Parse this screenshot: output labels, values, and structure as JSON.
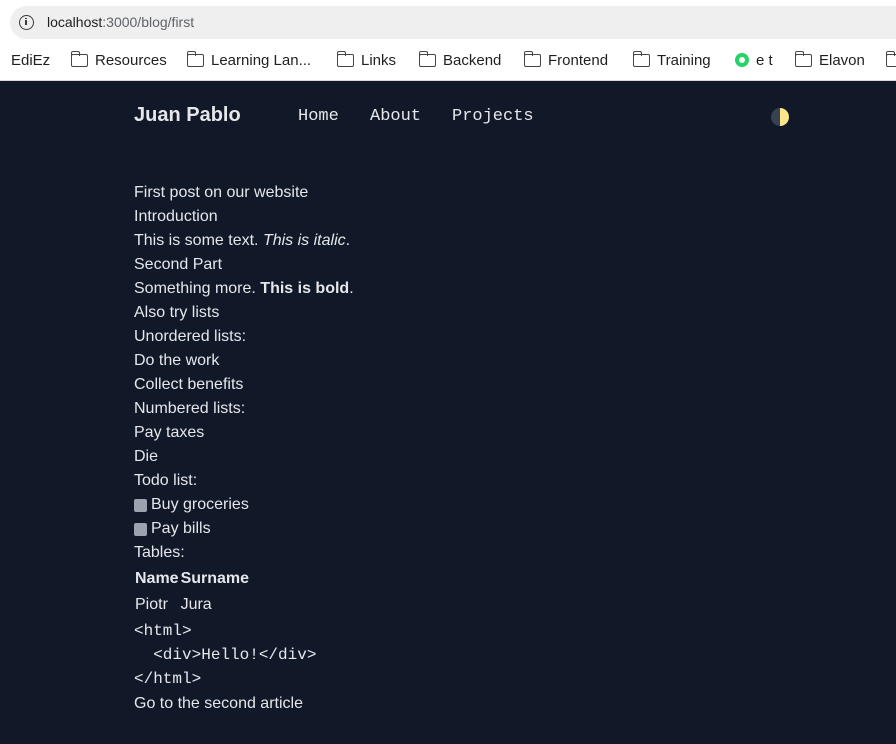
{
  "browser": {
    "url_host": "localhost",
    "url_path": ":3000/blog/first",
    "bookmarks": [
      {
        "label": "EdiEz",
        "icon": "none"
      },
      {
        "label": "Resources",
        "icon": "folder-icon"
      },
      {
        "label": "Learning Lan...",
        "icon": "folder-icon"
      },
      {
        "label": "Links",
        "icon": "folder-icon"
      },
      {
        "label": "Backend",
        "icon": "folder-icon"
      },
      {
        "label": "Frontend",
        "icon": "folder-icon"
      },
      {
        "label": "Training",
        "icon": "folder-icon"
      },
      {
        "label": "e t",
        "icon": "whatsapp-icon"
      },
      {
        "label": "Elavon",
        "icon": "folder-icon"
      }
    ]
  },
  "site": {
    "brand": "Juan Pablo",
    "nav": [
      "Home",
      "About",
      "Projects"
    ],
    "theme_toggle_icon": "half-moon-icon"
  },
  "post": {
    "title": "First post on our website",
    "intro_heading": "Introduction",
    "intro_text": "This is some text.",
    "intro_italic": "This is italic",
    "intro_period": ".",
    "second_heading": "Second Part",
    "second_text": "Something more.",
    "second_bold": "This is bold",
    "second_period": ".",
    "lists_heading": "Also try lists",
    "unordered_label": "Unordered lists:",
    "unordered": [
      "Do the work",
      "Collect benefits"
    ],
    "numbered_label": "Numbered lists:",
    "numbered": [
      "Pay taxes",
      "Die"
    ],
    "todo_label": "Todo list:",
    "todo": [
      "Buy groceries",
      "Pay bills"
    ],
    "tables_label": "Tables:",
    "table": {
      "headers": [
        "Name",
        "Surname"
      ],
      "rows": [
        [
          "Piotr",
          "Jura"
        ]
      ]
    },
    "code": [
      "<html>",
      "  <div>Hello!</div>",
      "</html>"
    ],
    "next_link": "Go to the second article"
  },
  "colors": {
    "page_bg": "#111827",
    "text": "#e5e7eb",
    "checkbox": "#9ca3af"
  }
}
